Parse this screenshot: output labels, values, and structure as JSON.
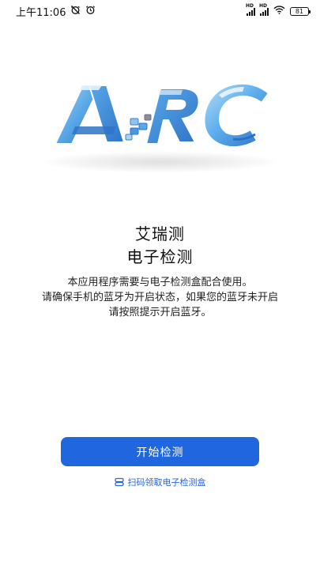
{
  "status_bar": {
    "time": "上午11:06",
    "battery_level": "81",
    "signal_labels": [
      "HD",
      "HD"
    ]
  },
  "logo": {
    "text": "ARC",
    "colors": {
      "blue_dark": "#2f74c8",
      "blue_mid": "#5aa8e8",
      "blue_light": "#a9d3f3",
      "gray": "#8a9099"
    }
  },
  "main": {
    "title_line1": "艾瑞测",
    "title_line2": "电子检测",
    "description_lines": [
      "本应用程序需要与电子检测盒配合使用。",
      "请确保手机的蓝牙为开启状态，如果您的蓝牙未开启",
      "请按照提示开启蓝牙。"
    ]
  },
  "actions": {
    "start_label": "开始检测",
    "scan_label": "扫码领取电子检测盒"
  },
  "colors": {
    "primary": "#2066de",
    "link": "#2b63d8"
  }
}
